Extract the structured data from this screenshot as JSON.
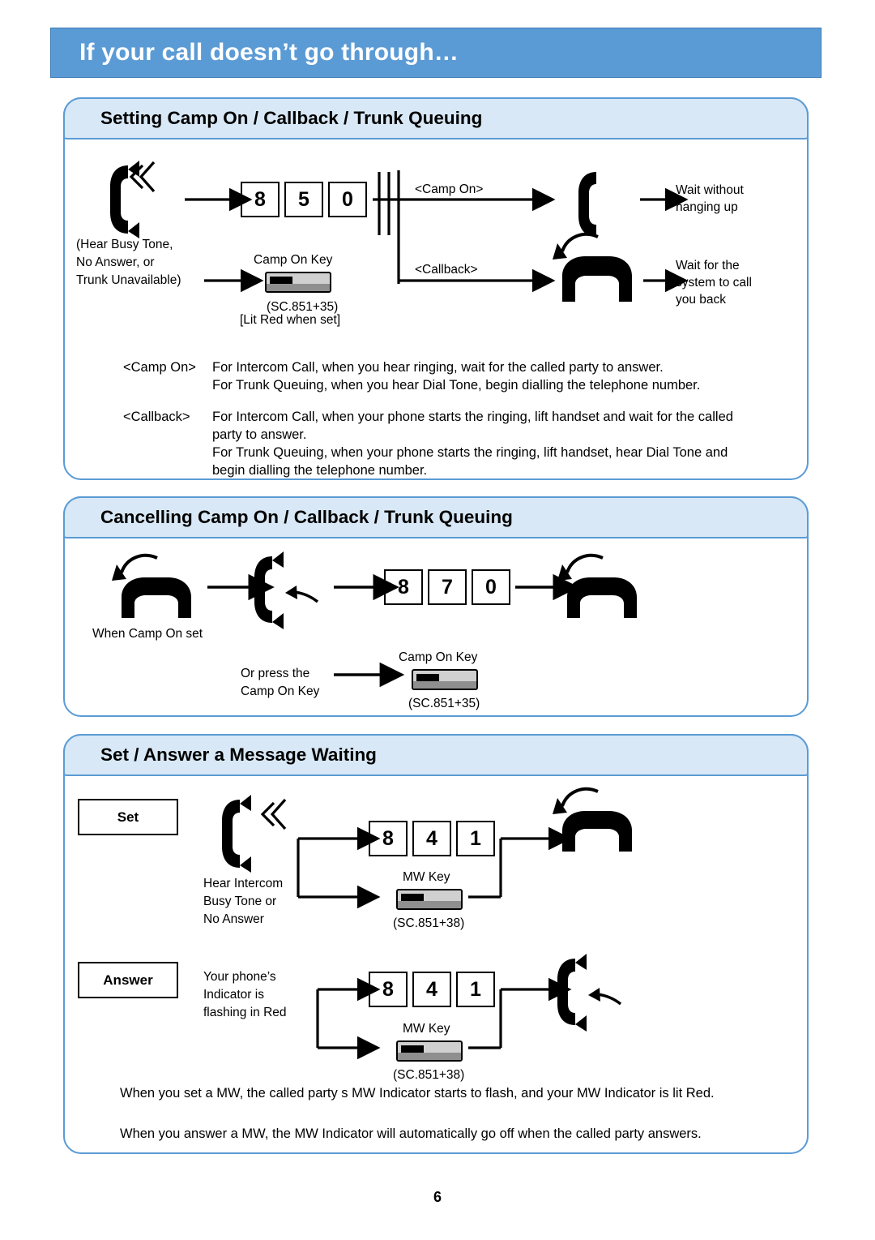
{
  "page": {
    "title": "If your call doesn’t go through…",
    "number": "6"
  },
  "sections": [
    {
      "heading": "Setting Camp On / Callback / Trunk Queuing",
      "labels": {
        "left_note_line1": "(Hear Busy Tone,",
        "left_note_line2": "No Answer, or",
        "left_note_line3": "Trunk Unavailable)",
        "keys": [
          "8",
          "5",
          "0"
        ],
        "key_name": "Camp On Key",
        "key_code": "(SC.851+35)",
        "key_state": "[Lit Red when set]",
        "branch_camp_on": "<Camp On>",
        "branch_callback": "<Callback>",
        "result_top_line1": "Wait without",
        "result_top_line2": "hanging up",
        "result_bottom_line1": "Wait for the",
        "result_bottom_line2": "system to call",
        "result_bottom_line3": "you back"
      },
      "notes": [
        {
          "tag": "<Camp On>",
          "lines": [
            "For Intercom Call, when you hear ringing, wait for the called party to answer.",
            "For Trunk Queuing, when you hear Dial Tone, begin dialling the telephone number."
          ]
        },
        {
          "tag": "<Callback>",
          "lines": [
            "For Intercom Call, when your phone starts the ringing, lift handset and wait for the called",
            "party to answer.",
            "For Trunk Queuing, when your phone starts the ringing, lift handset, hear Dial Tone and",
            "begin dialling the telephone number."
          ]
        }
      ]
    },
    {
      "heading": "Cancelling Camp On / Callback / Trunk Queuing",
      "labels": {
        "when_set": "When Camp On set",
        "keys": [
          "8",
          "7",
          "0"
        ],
        "or_press_line1": "Or press the",
        "or_press_line2": "Camp On Key",
        "key_name": "Camp On Key",
        "key_code": "(SC.851+35)"
      }
    },
    {
      "heading": "Set / Answer a Message Waiting",
      "labels": {
        "set_box": "Set",
        "answer_box": "Answer",
        "set_note_line1": "Hear Intercom",
        "set_note_line2": "Busy Tone or",
        "set_note_line3": "No Answer",
        "set_keys": [
          "8",
          "4",
          "1"
        ],
        "set_key_name": "MW Key",
        "set_key_code": "(SC.851+38)",
        "answer_note_line1": "Your phone’s",
        "answer_note_line2": "Indicator is",
        "answer_note_line3": "flashing in Red",
        "answer_keys": [
          "8",
          "4",
          "1"
        ],
        "answer_key_name": "MW Key",
        "answer_key_code": "(SC.851+38)"
      },
      "notes": [
        "When you set a MW, the called party s MW Indicator starts to flash, and your MW Indicator is lit Red.",
        "When you answer a MW, the MW Indicator will automatically go off when the called party answers."
      ]
    }
  ],
  "colors": {
    "banner": "#5b9bd5",
    "panel_border": "#5b9bd5",
    "panel_head": "#d8e8f6"
  }
}
